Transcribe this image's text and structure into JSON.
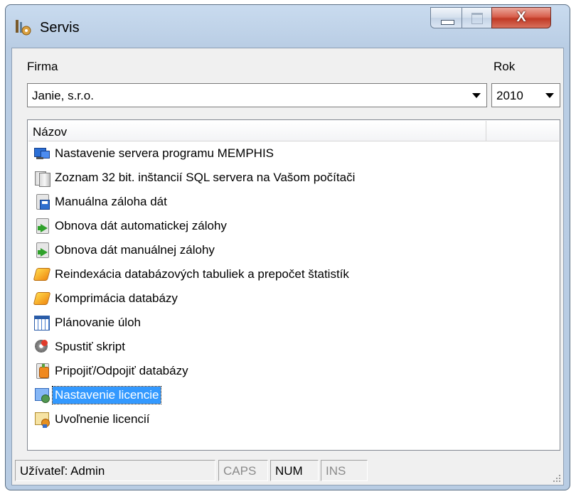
{
  "window": {
    "title": "Servis",
    "close_glyph": "X"
  },
  "firma": {
    "label": "Firma",
    "value": "Janie, s.r.o."
  },
  "rok": {
    "label": "Rok",
    "value": "2010"
  },
  "list": {
    "column_header": "Názov",
    "items": [
      {
        "label": "Nastavenie servera programu MEMPHIS",
        "icon": "server-settings-icon"
      },
      {
        "label": "Zoznam 32 bit. inštancií SQL servera na Vašom počítači",
        "icon": "sql-server-icon"
      },
      {
        "label": "Manuálna záloha dát",
        "icon": "manual-backup-icon"
      },
      {
        "label": "Obnova dát automatickej zálohy",
        "icon": "restore-auto-icon"
      },
      {
        "label": "Obnova dát manuálnej zálohy",
        "icon": "restore-manual-icon"
      },
      {
        "label": "Reindexácia databázových tabuliek a prepočet štatistík",
        "icon": "reindex-icon"
      },
      {
        "label": "Komprimácia databázy",
        "icon": "compress-icon"
      },
      {
        "label": "Plánovanie úloh",
        "icon": "calendar-icon"
      },
      {
        "label": "Spustiť skript",
        "icon": "script-gear-icon"
      },
      {
        "label": "Pripojiť/Odpojiť databázy",
        "icon": "attach-db-icon"
      },
      {
        "label": "Nastavenie licencie",
        "icon": "license-settings-icon",
        "selected": true
      },
      {
        "label": "Uvoľnenie licencií",
        "icon": "license-release-icon"
      }
    ]
  },
  "statusbar": {
    "user": "Užívateľ: Admin",
    "caps": "CAPS",
    "num": "NUM",
    "ins": "INS"
  },
  "colors": {
    "selection": "#3399ff",
    "titlebar": "#c9dbef",
    "close_button": "#c13a26"
  }
}
